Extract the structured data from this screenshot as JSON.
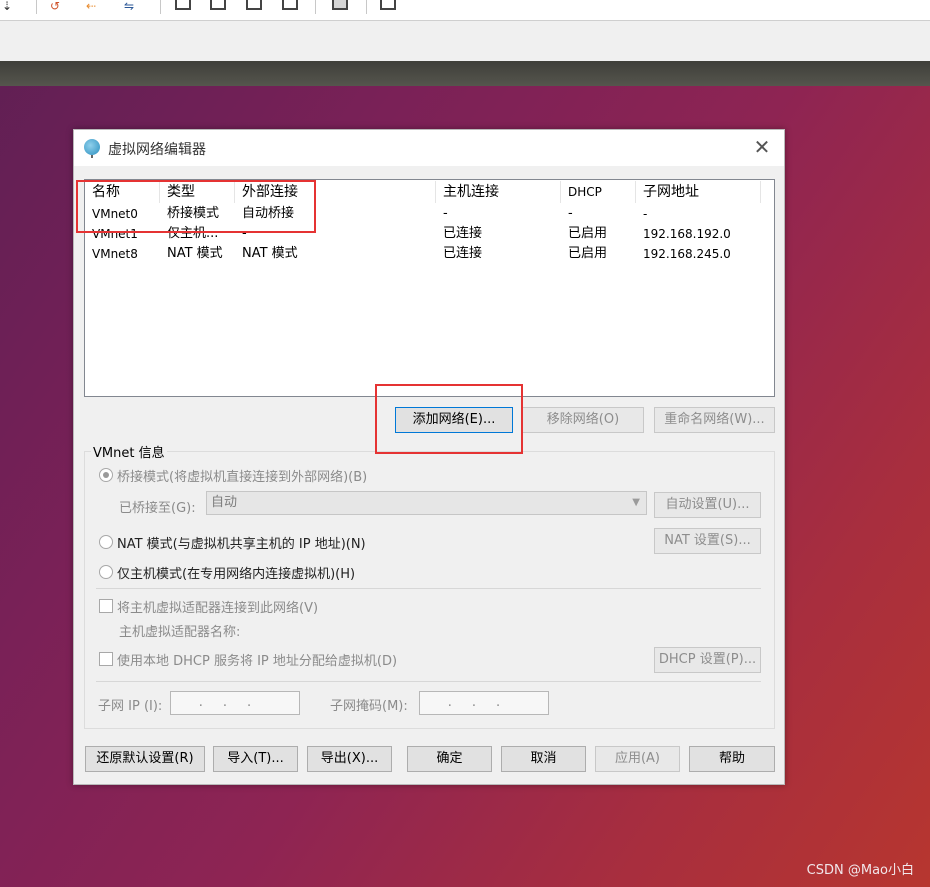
{
  "dialog": {
    "title": "虚拟网络编辑器",
    "columns": [
      "名称",
      "类型",
      "外部连接",
      "主机连接",
      "DHCP",
      "子网地址"
    ],
    "rows": [
      {
        "name": "VMnet0",
        "type": "桥接模式",
        "external": "自动桥接",
        "host": "-",
        "dhcp": "-",
        "subnet": "-"
      },
      {
        "name": "VMnet1",
        "type": "仅主机...",
        "external": "-",
        "host": "已连接",
        "dhcp": "已启用",
        "subnet": "192.168.192.0"
      },
      {
        "name": "VMnet8",
        "type": "NAT 模式",
        "external": "NAT 模式",
        "host": "已连接",
        "dhcp": "已启用",
        "subnet": "192.168.245.0"
      }
    ],
    "list_buttons": {
      "add": "添加网络(E)...",
      "remove": "移除网络(O)",
      "rename": "重命名网络(W)..."
    },
    "info": {
      "group_label": "VMnet 信息",
      "bridged_radio": "桥接模式(将虚拟机直接连接到外部网络)(B)",
      "bridged_to_label": "已桥接至(G):",
      "bridged_to_value": "自动",
      "auto_settings": "自动设置(U)...",
      "nat_radio": "NAT 模式(与虚拟机共享主机的 IP 地址)(N)",
      "nat_settings": "NAT 设置(S)...",
      "host_only_radio": "仅主机模式(在专用网络内连接虚拟机)(H)",
      "connect_adapter_check": "将主机虚拟适配器连接到此网络(V)",
      "adapter_name_label": "主机虚拟适配器名称:",
      "dhcp_check": "使用本地 DHCP 服务将 IP 地址分配给虚拟机(D)",
      "dhcp_settings": "DHCP 设置(P)...",
      "subnet_ip_label": "子网 IP (I):",
      "subnet_ip_value": "...",
      "subnet_mask_label": "子网掩码(M):",
      "subnet_mask_value": "..."
    },
    "footer_buttons": {
      "restore": "还原默认设置(R)",
      "import": "导入(T)...",
      "export": "导出(X)...",
      "ok": "确定",
      "cancel": "取消",
      "apply": "应用(A)",
      "help": "帮助"
    }
  },
  "watermark": "CSDN @Mao小白",
  "colors": {
    "annotation": "#e53333",
    "dialog_bg": "#f0f0f0",
    "focus": "#0078d7"
  }
}
